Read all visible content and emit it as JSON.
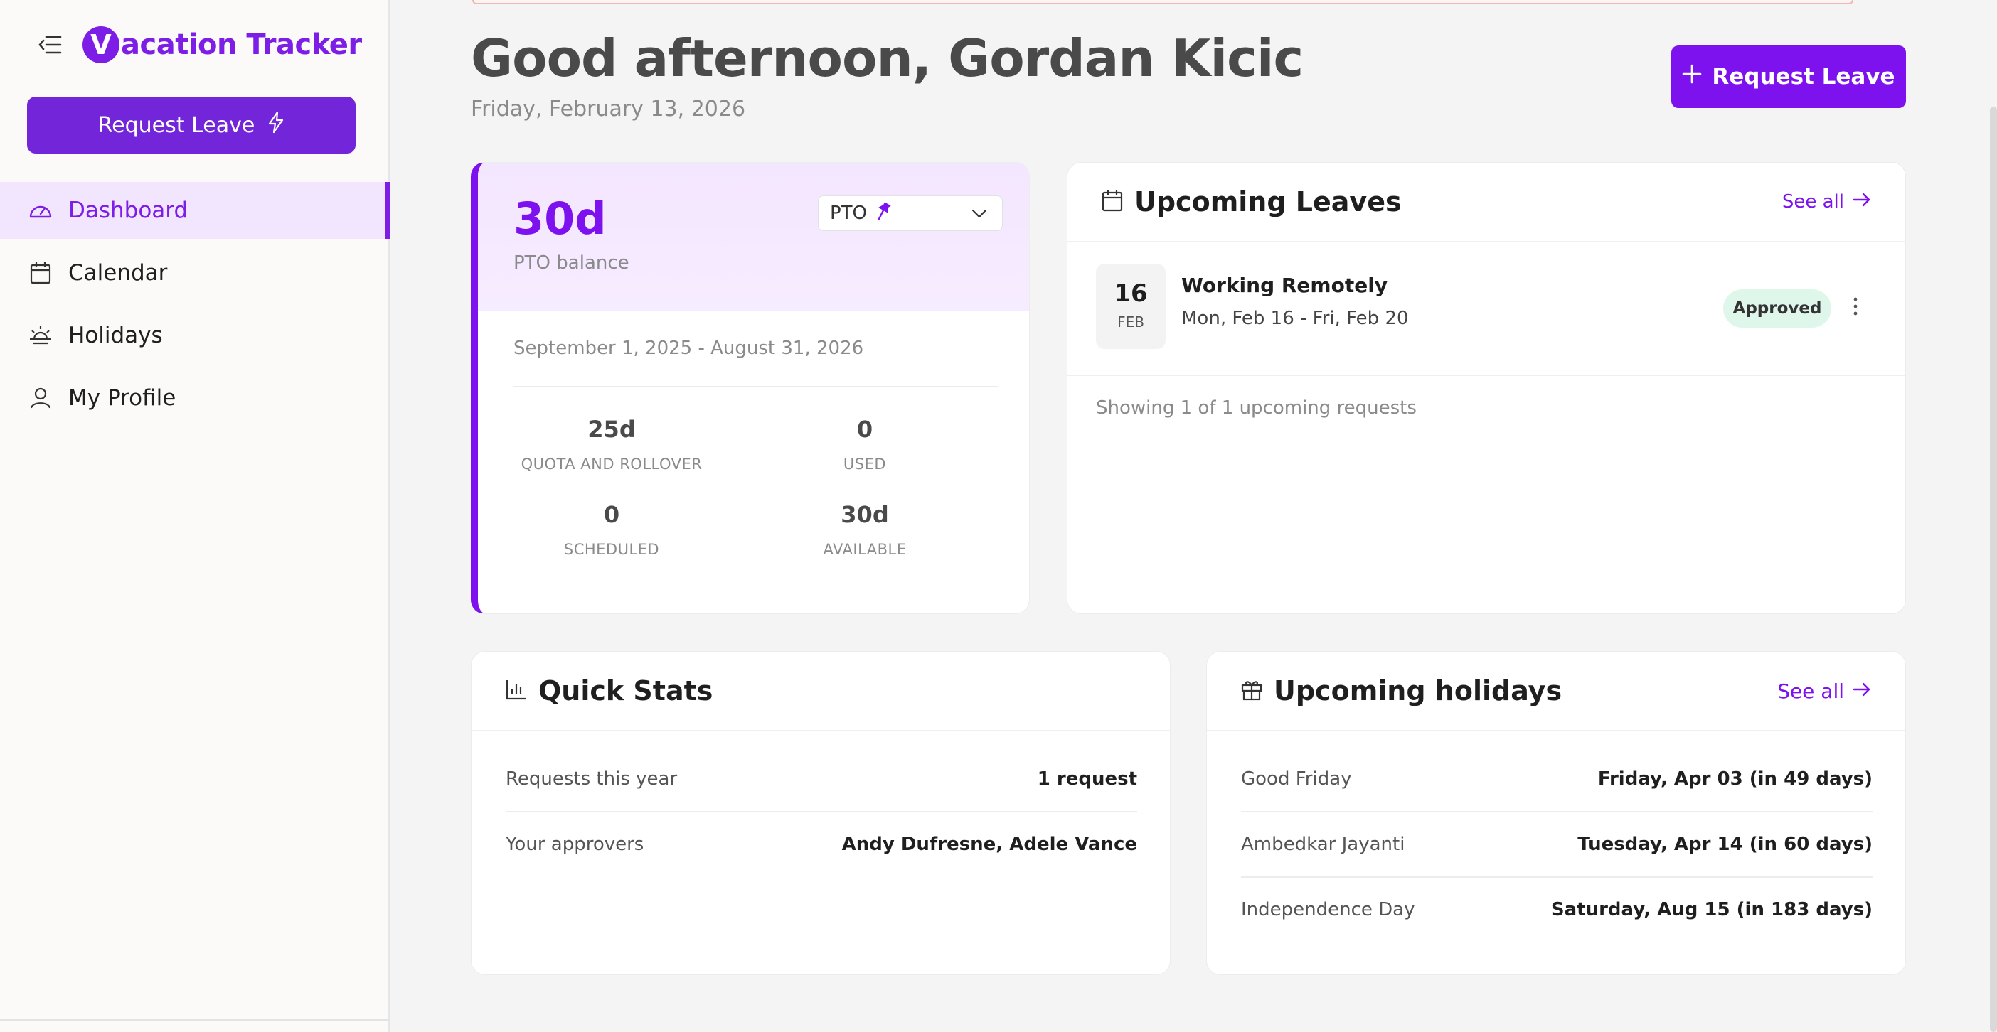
{
  "app": {
    "logo_letter": "V",
    "logo_text": "acation Tracker",
    "brand_color": "#7d1ee6"
  },
  "sidebar": {
    "request_button_label": "Request Leave",
    "items": [
      {
        "label": "Dashboard",
        "icon": "gauge-icon",
        "active": true
      },
      {
        "label": "Calendar",
        "icon": "calendar-icon",
        "active": false
      },
      {
        "label": "Holidays",
        "icon": "sunrise-icon",
        "active": false
      },
      {
        "label": "My Profile",
        "icon": "user-icon",
        "active": false
      }
    ]
  },
  "header": {
    "greeting": "Good afternoon, Gordan Kicic",
    "date": "Friday, February 13, 2026",
    "request_button_label": "Request Leave"
  },
  "balance": {
    "value": "30d",
    "label": "PTO balance",
    "leave_type": "PTO",
    "period": "September 1, 2025 - August 31, 2026",
    "stats": [
      {
        "value": "25d",
        "label": "QUOTA AND ROLLOVER"
      },
      {
        "value": "0",
        "label": "USED"
      },
      {
        "value": "0",
        "label": "SCHEDULED"
      },
      {
        "value": "30d",
        "label": "AVAILABLE"
      }
    ]
  },
  "upcoming_leaves": {
    "title": "Upcoming Leaves",
    "see_all": "See all",
    "items": [
      {
        "day": "16",
        "month": "FEB",
        "title": "Working Remotely",
        "range": "Mon, Feb 16 - Fri, Feb 20",
        "status": "Approved"
      }
    ],
    "showing": "Showing 1 of 1 upcoming requests"
  },
  "quick_stats": {
    "title": "Quick Stats",
    "rows": [
      {
        "label": "Requests this year",
        "value": "1 request"
      },
      {
        "label": "Your approvers",
        "value": "Andy Dufresne, Adele Vance"
      }
    ]
  },
  "holidays": {
    "title": "Upcoming holidays",
    "see_all": "See all",
    "rows": [
      {
        "label": "Good Friday",
        "value": "Friday, Apr 03 (in 49 days)"
      },
      {
        "label": "Ambedkar Jayanti",
        "value": "Tuesday, Apr 14 (in 60 days)"
      },
      {
        "label": "Independence Day",
        "value": "Saturday, Aug 15 (in 183 days)"
      }
    ]
  }
}
